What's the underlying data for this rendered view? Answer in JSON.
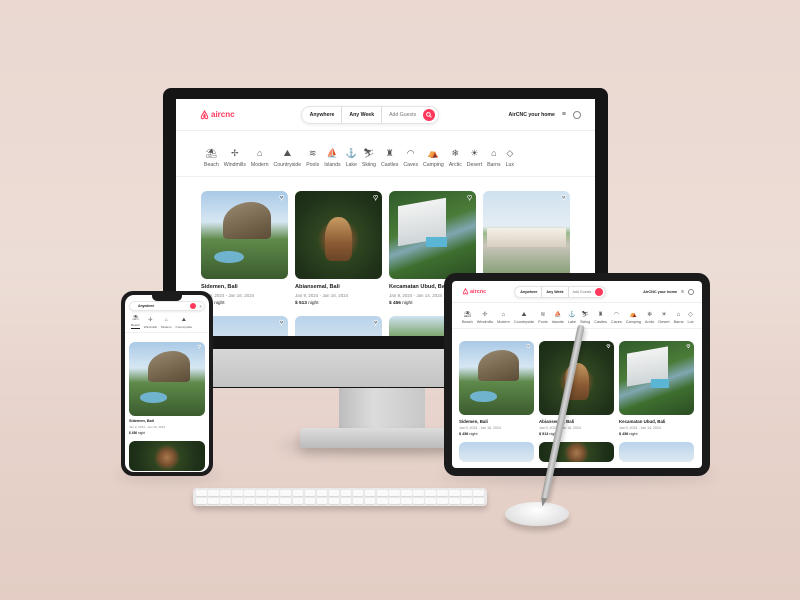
{
  "brand": {
    "name": "aircnc",
    "accent": "#ff385c"
  },
  "search": {
    "location": "Anywhere",
    "dates": "Any Week",
    "guests": "Add Guests"
  },
  "header": {
    "host_link": "AirCNC your home"
  },
  "categories": [
    {
      "label": "Beach",
      "icon": "beach-icon",
      "glyph": "⛱"
    },
    {
      "label": "Windmills",
      "icon": "windmill-icon",
      "glyph": "✢"
    },
    {
      "label": "Modern",
      "icon": "modern-home-icon",
      "glyph": "⌂"
    },
    {
      "label": "Countryside",
      "icon": "countryside-icon",
      "glyph": "⛰"
    },
    {
      "label": "Pools",
      "icon": "pool-icon",
      "glyph": "≋"
    },
    {
      "label": "Islands",
      "icon": "island-icon",
      "glyph": "⛵"
    },
    {
      "label": "Lake",
      "icon": "lake-icon",
      "glyph": "⚓"
    },
    {
      "label": "Skiing",
      "icon": "skiing-icon",
      "glyph": "⛷"
    },
    {
      "label": "Castles",
      "icon": "castle-icon",
      "glyph": "♜"
    },
    {
      "label": "Caves",
      "icon": "cave-icon",
      "glyph": "◠"
    },
    {
      "label": "Camping",
      "icon": "camping-icon",
      "glyph": "⛺"
    },
    {
      "label": "Arctic",
      "icon": "arctic-icon",
      "glyph": "❄"
    },
    {
      "label": "Desert",
      "icon": "desert-icon",
      "glyph": "☀"
    },
    {
      "label": "Barns",
      "icon": "barn-icon",
      "glyph": "⌂"
    },
    {
      "label": "Lux",
      "icon": "diamond-icon",
      "glyph": "◇"
    }
  ],
  "listings": [
    {
      "title": "Sidemen, Bali",
      "dates": "Jan 9, 2024 - Jan 16, 2024",
      "price": "$ 456",
      "unit": "night"
    },
    {
      "title": "Abiansemal, Bali",
      "dates": "Jan 9, 2024 - Jan 16, 2024",
      "price": "$ 513",
      "unit": "night"
    },
    {
      "title": "Kecamatan Ubud, Bali",
      "dates": "Jan 9, 2024 - Jan 14, 2024",
      "price": "$ 456",
      "unit": "night"
    }
  ],
  "tablet_dates": [
    "Jan 9, 2024 - Jan 16, 2024",
    "Jan 9, 2024 - Jan 16, 2024",
    "Jan 9, 2024 - Jan 14, 2024"
  ],
  "icons": {
    "heart": "♥",
    "menu": "≡",
    "search": "⌕"
  }
}
